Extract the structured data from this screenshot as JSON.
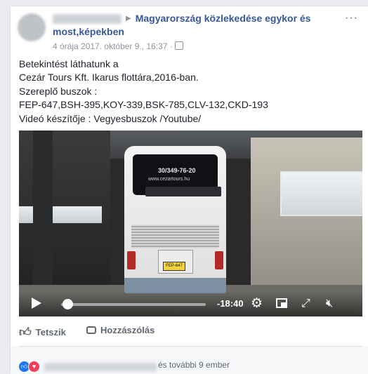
{
  "post": {
    "group_name": "Magyarország közlekedése egykor és most,képekben",
    "meta_time": "4 órája 2017. október 9., 16:37 ·",
    "more_label": "···",
    "text_lines": [
      "Betekintést láthatunk a",
      "Cezár Tours Kft. Ikarus flottára,2016-ban.",
      "Szereplő buszok :",
      "FEP-647,BSH-395,KOY-339,BSK-785,CLV-132,CKD-193",
      "Videó készítője : Vegyesbuszok /Youtube/"
    ]
  },
  "video": {
    "bus_phone": "30/349-76-20",
    "bus_url": "www.cezartours.hu",
    "plate": "FEP-647",
    "time_remaining": "-18:40",
    "progress": 0.0,
    "icons": {
      "play": "play-icon",
      "settings": "gear-icon",
      "pip": "picture-in-picture-icon",
      "fullscreen": "fullscreen-icon",
      "mute": "mute-icon"
    }
  },
  "actions": {
    "like_label": "Tetszik",
    "comment_label": "Hozzászólás"
  },
  "footer": {
    "others_text": "és további 9 ember"
  },
  "colors": {
    "link": "#365899",
    "like_blue": "#1877f2",
    "love_red": "#f33e58"
  }
}
